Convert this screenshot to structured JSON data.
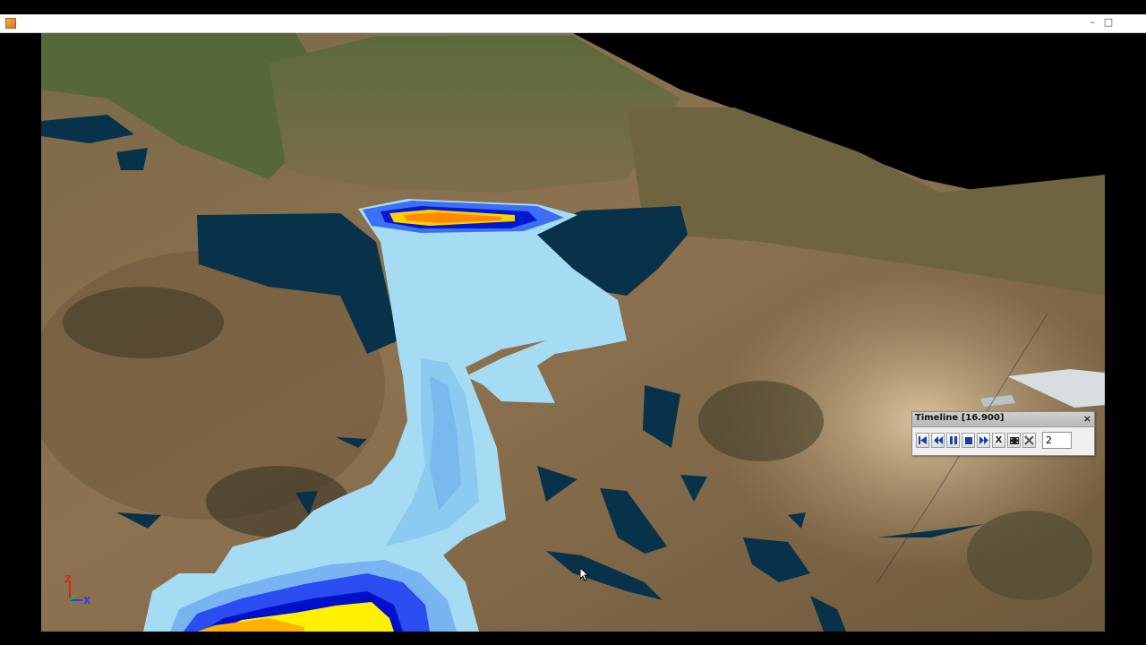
{
  "window": {
    "minimize_icon": "minimize-icon",
    "maximize_icon": "maximize-icon",
    "close_icon": "close-icon"
  },
  "axes": {
    "z_label": "Z",
    "x_label": "X",
    "z_color": "#e02020",
    "x_color": "#2a3cff",
    "y_color": "#20c020"
  },
  "timeline": {
    "title": "Timeline [16.900]",
    "close_glyph": "×",
    "buttons": [
      {
        "name": "first-frame-button",
        "icon": "skip-to-start-icon"
      },
      {
        "name": "step-back-button",
        "icon": "rewind-icon"
      },
      {
        "name": "pause-button",
        "icon": "pause-icon"
      },
      {
        "name": "stop-button",
        "icon": "stop-icon"
      },
      {
        "name": "step-forward-button",
        "icon": "fast-forward-icon"
      },
      {
        "name": "clear-button",
        "label": "X"
      },
      {
        "name": "record-button",
        "icon": "film-icon"
      },
      {
        "name": "settings-button",
        "icon": "tools-icon"
      }
    ],
    "step_value": "2"
  },
  "colors": {
    "flood_light": "#a6dcf3",
    "flood_mid": "#79b9ee",
    "flood_blue": "#2a4cf0",
    "flood_yellow": "#fff000",
    "flood_orange": "#ff9a00",
    "water_shadow": "#08324a"
  }
}
